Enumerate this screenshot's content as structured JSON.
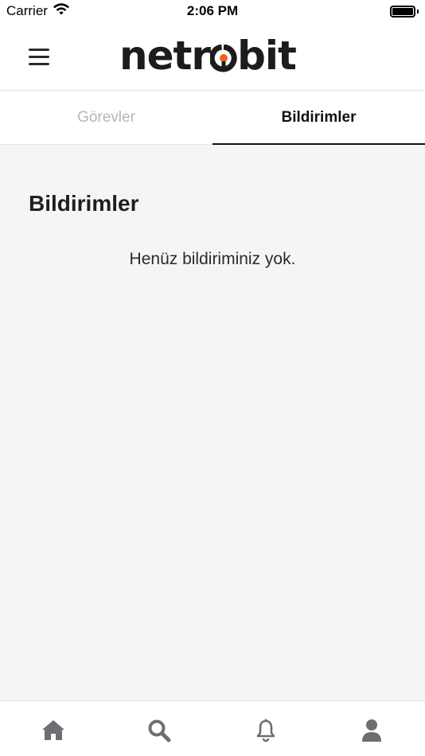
{
  "status_bar": {
    "carrier": "Carrier",
    "time": "2:06 PM"
  },
  "header": {
    "logo_part1": "netr",
    "logo_part2": "bit",
    "menu_icon": "hamburger-menu-icon"
  },
  "tabs": [
    {
      "label": "Görevler",
      "active": false
    },
    {
      "label": "Bildirimler",
      "active": true
    }
  ],
  "main": {
    "title": "Bildirimler",
    "empty_message": "Henüz bildiriminiz yok."
  },
  "bottom_nav": {
    "items": [
      "home-icon",
      "search-icon",
      "bell-icon",
      "user-icon"
    ]
  },
  "colors": {
    "accent": "#e8661f",
    "text_dark": "#1c1c1c",
    "inactive_tab": "#b6b6bb",
    "background": "#f5f5f7",
    "icon_gray": "#6e6e73"
  }
}
